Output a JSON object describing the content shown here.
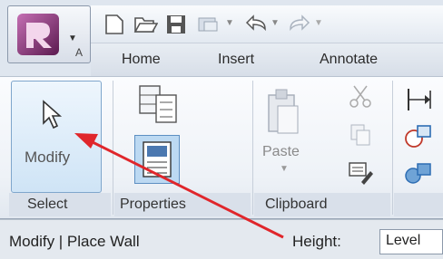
{
  "app_button": {
    "letter": "A",
    "icon": "revit-logo-icon"
  },
  "quick_access": {
    "icons": [
      "new-icon",
      "open-icon",
      "save-icon",
      "sync-icon",
      "undo-icon",
      "redo-icon"
    ]
  },
  "tabs": [
    {
      "label": "Home"
    },
    {
      "label": "Insert"
    },
    {
      "label": "Annotate"
    }
  ],
  "ribbon": {
    "select_panel": {
      "title": "Select",
      "modify_label": "Modify"
    },
    "properties_panel": {
      "title": "Properties"
    },
    "clipboard_panel": {
      "title": "Clipboard",
      "paste_label": "Paste"
    }
  },
  "statusbar": {
    "context": "Modify | Place Wall",
    "height_label": "Height:",
    "height_value": "Level"
  },
  "colors": {
    "annotation_arrow": "#e0262b",
    "selected_button": "#cfe4f6",
    "ribbon_bg": "#eef2f7"
  }
}
